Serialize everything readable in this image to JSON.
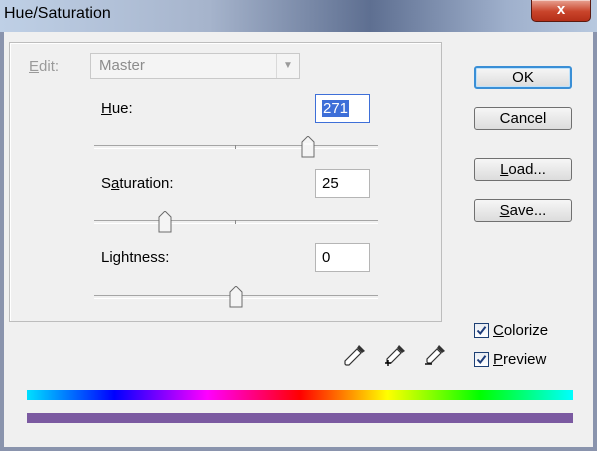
{
  "window": {
    "title": "Hue/Saturation",
    "close_glyph": "x"
  },
  "edit": {
    "label": "Edit:",
    "value": "Master"
  },
  "hue": {
    "label": "Hue:",
    "value": "271"
  },
  "saturation": {
    "label": "Saturation:",
    "value": "25"
  },
  "lightness": {
    "label": "Lightness:",
    "value": "0"
  },
  "buttons": {
    "ok": "OK",
    "cancel": "Cancel",
    "load": "Load...",
    "save": "Save..."
  },
  "options": {
    "colorize": {
      "label": "Colorize",
      "checked": true
    },
    "preview": {
      "label": "Preview",
      "checked": true
    }
  },
  "colors": {
    "result_bar": "#7b5aa1",
    "accent": "#3e6fd8"
  }
}
